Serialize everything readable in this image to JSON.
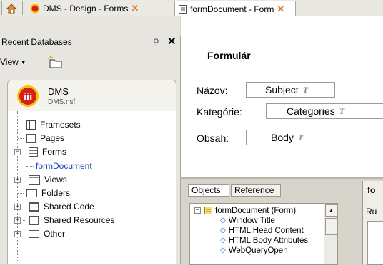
{
  "tabs": [
    {
      "label": "",
      "icon": "home-icon"
    },
    {
      "label": "DMS - Design - Forms",
      "icon": "dms-logo-icon",
      "close": "✕"
    },
    {
      "label": "formDocument - Form",
      "icon": "form-icon",
      "close": "✕"
    }
  ],
  "left_panel": {
    "title": "Recent Databases",
    "view_menu": "View",
    "database": {
      "name": "DMS",
      "file": "DMS.nsf",
      "logo": "iii"
    },
    "tree": [
      {
        "label": "Framesets",
        "icon": "frameset-icon"
      },
      {
        "label": "Pages",
        "icon": "page-icon"
      },
      {
        "label": "Forms",
        "icon": "forms-icon",
        "expanded": true
      },
      {
        "label": "formDocument",
        "icon": "",
        "selected": true
      },
      {
        "label": "Views",
        "icon": "views-icon"
      },
      {
        "label": "Folders",
        "icon": "folder-icon"
      },
      {
        "label": "Shared Code",
        "icon": "shared-code-icon"
      },
      {
        "label": "Shared Resources",
        "icon": "shared-resources-icon"
      },
      {
        "label": "Other",
        "icon": "other-icon"
      }
    ]
  },
  "form": {
    "heading": "Formulár",
    "fields": [
      {
        "label": "Názov:",
        "value": "Subject"
      },
      {
        "label": "Kategórie:",
        "value": "Categories"
      },
      {
        "label": "Obsah:",
        "value": "Body"
      }
    ],
    "field_type_glyph": "T"
  },
  "bottom": {
    "tabs": [
      "Objects",
      "Reference"
    ],
    "right_tab": "fo",
    "right_label": "Ru",
    "objects": [
      {
        "label": "formDocument (Form)",
        "root": true
      },
      {
        "label": "Window Title"
      },
      {
        "label": "HTML Head Content"
      },
      {
        "label": "HTML Body Attributes"
      },
      {
        "label": "WebQueryOpen"
      }
    ]
  },
  "colors": {
    "accent": "#e07a2e",
    "selected_text": "#1a3fb0",
    "logo_red": "#d51e1e",
    "logo_yellow": "#f5c400"
  }
}
